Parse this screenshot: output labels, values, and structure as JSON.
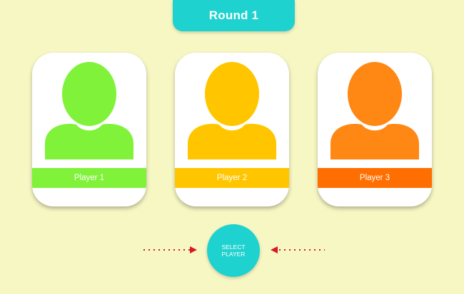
{
  "round": {
    "title": "Round 1"
  },
  "players": [
    {
      "label": "Player 1",
      "color": "#80f23a",
      "strip_color": "#80f23a"
    },
    {
      "label": "Player 2",
      "color": "#ffc600",
      "strip_color": "#ffc600"
    },
    {
      "label": "Player 3",
      "color": "#ff8714",
      "strip_color": "#ff6e00"
    }
  ],
  "select_button": {
    "label": "SELECT\nPLAYER",
    "color": "#1ed2cf"
  },
  "arrows": {
    "left": {
      "icon": "dotted-arrow-right-icon",
      "color": "#d71920"
    },
    "right": {
      "icon": "dotted-arrow-left-icon",
      "color": "#d71920"
    }
  },
  "colors": {
    "background": "#f7f7c4",
    "accent": "#1ed2cf"
  }
}
